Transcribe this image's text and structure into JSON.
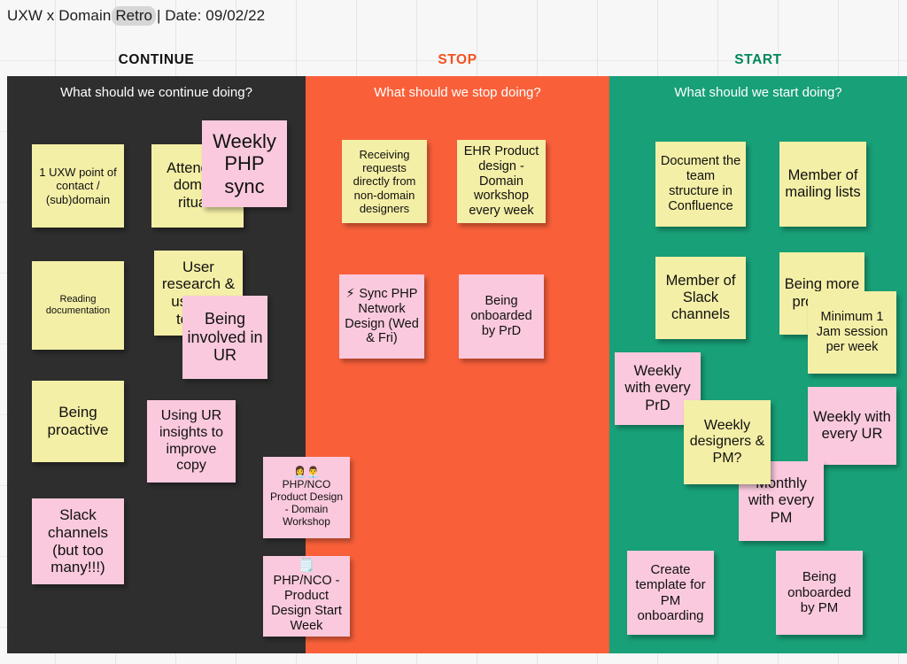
{
  "board": {
    "title_prefix": "UXW x Domain ",
    "title_highlight": "Retro",
    "title_suffix": " | Date: 09/02/22",
    "colors": {
      "continue_bg": "#2e2e2e",
      "stop_bg": "#f9603a",
      "start_bg": "#18a078",
      "note_yellow": "#f4efa6",
      "note_pink": "#fac9dd",
      "continue_label": "#111111",
      "stop_label": "#f4511e",
      "start_label": "#00875a"
    }
  },
  "columns": [
    {
      "key": "continue",
      "header_label": "CONTINUE",
      "banner": "What should we continue doing?",
      "notes": [
        {
          "id": "c1",
          "color": "yellow",
          "text": "1 UXW point of contact / (sub)domain",
          "emoji": ""
        },
        {
          "id": "c2",
          "color": "yellow",
          "text": "Attending domain rituals",
          "emoji": ""
        },
        {
          "id": "c3",
          "color": "pink",
          "text": "Weekly PHP sync",
          "emoji": ""
        },
        {
          "id": "c4",
          "color": "yellow",
          "text": "Reading documentation",
          "emoji": ""
        },
        {
          "id": "c5",
          "color": "yellow",
          "text": "User research & usability testing",
          "emoji": ""
        },
        {
          "id": "c6",
          "color": "pink",
          "text": "Being involved in UR",
          "emoji": ""
        },
        {
          "id": "c7",
          "color": "yellow",
          "text": "Being proactive",
          "emoji": ""
        },
        {
          "id": "c8",
          "color": "pink",
          "text": "Using UR insights to improve copy",
          "emoji": ""
        },
        {
          "id": "c9",
          "color": "pink",
          "text": "Slack channels (but too many!!!)",
          "emoji": ""
        },
        {
          "id": "c10",
          "color": "pink",
          "text": "PHP/NCO Product Design - Domain Workshop",
          "emoji": "👩‍💼👨‍💼"
        },
        {
          "id": "c11",
          "color": "pink",
          "text": "PHP/NCO - Product Design Start Week",
          "emoji": "🗒️"
        }
      ]
    },
    {
      "key": "stop",
      "header_label": "STOP",
      "banner": "What should we stop doing?",
      "notes": [
        {
          "id": "s1",
          "color": "yellow",
          "text": "Receiving requests directly from non-domain designers",
          "emoji": ""
        },
        {
          "id": "s2",
          "color": "yellow",
          "text": "EHR Product design - Domain workshop every week",
          "emoji": ""
        },
        {
          "id": "s3",
          "color": "pink",
          "text": "Sync PHP Network Design (Wed & Fri)",
          "emoji": "⚡"
        },
        {
          "id": "s4",
          "color": "pink",
          "text": "Being onboarded by PrD",
          "emoji": ""
        }
      ]
    },
    {
      "key": "start",
      "header_label": "START",
      "banner": "What should we start doing?",
      "notes": [
        {
          "id": "t1",
          "color": "yellow",
          "text": "Document the team structure in Confluence",
          "emoji": ""
        },
        {
          "id": "t2",
          "color": "yellow",
          "text": "Member of mailing lists",
          "emoji": ""
        },
        {
          "id": "t3",
          "color": "yellow",
          "text": "Member of Slack channels",
          "emoji": ""
        },
        {
          "id": "t4",
          "color": "yellow",
          "text": "Being more proactive",
          "emoji": ""
        },
        {
          "id": "t5",
          "color": "yellow",
          "text": "Minimum 1 Jam session per week",
          "emoji": ""
        },
        {
          "id": "t6",
          "color": "pink",
          "text": "Weekly with every PrD",
          "emoji": ""
        },
        {
          "id": "t7",
          "color": "yellow",
          "text": "Weekly designers & PM?",
          "emoji": ""
        },
        {
          "id": "t8",
          "color": "pink",
          "text": "Weekly with every UR",
          "emoji": ""
        },
        {
          "id": "t9",
          "color": "pink",
          "text": "Monthly with every PM",
          "emoji": ""
        },
        {
          "id": "t10",
          "color": "pink",
          "text": "Create template for PM onboarding",
          "emoji": ""
        },
        {
          "id": "t11",
          "color": "pink",
          "text": "Being onboarded by PM",
          "emoji": ""
        }
      ]
    }
  ]
}
